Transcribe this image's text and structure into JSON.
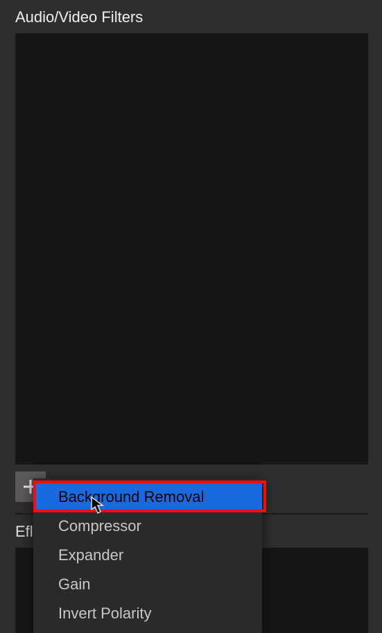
{
  "panel": {
    "title": "Audio/Video Filters"
  },
  "section_label_truncated": "Efl",
  "icons": {
    "plus_glyph": "+"
  },
  "context_menu": {
    "items": [
      {
        "label": "Background Removal",
        "hovered": true
      },
      {
        "label": "Compressor",
        "hovered": false
      },
      {
        "label": "Expander",
        "hovered": false
      },
      {
        "label": "Gain",
        "hovered": false
      },
      {
        "label": "Invert Polarity",
        "hovered": false
      }
    ]
  },
  "colors": {
    "selection": "#1a6adf",
    "highlight_border": "#f20d0d",
    "panel_bg": "#2e2e2e",
    "area_bg": "#161616"
  }
}
